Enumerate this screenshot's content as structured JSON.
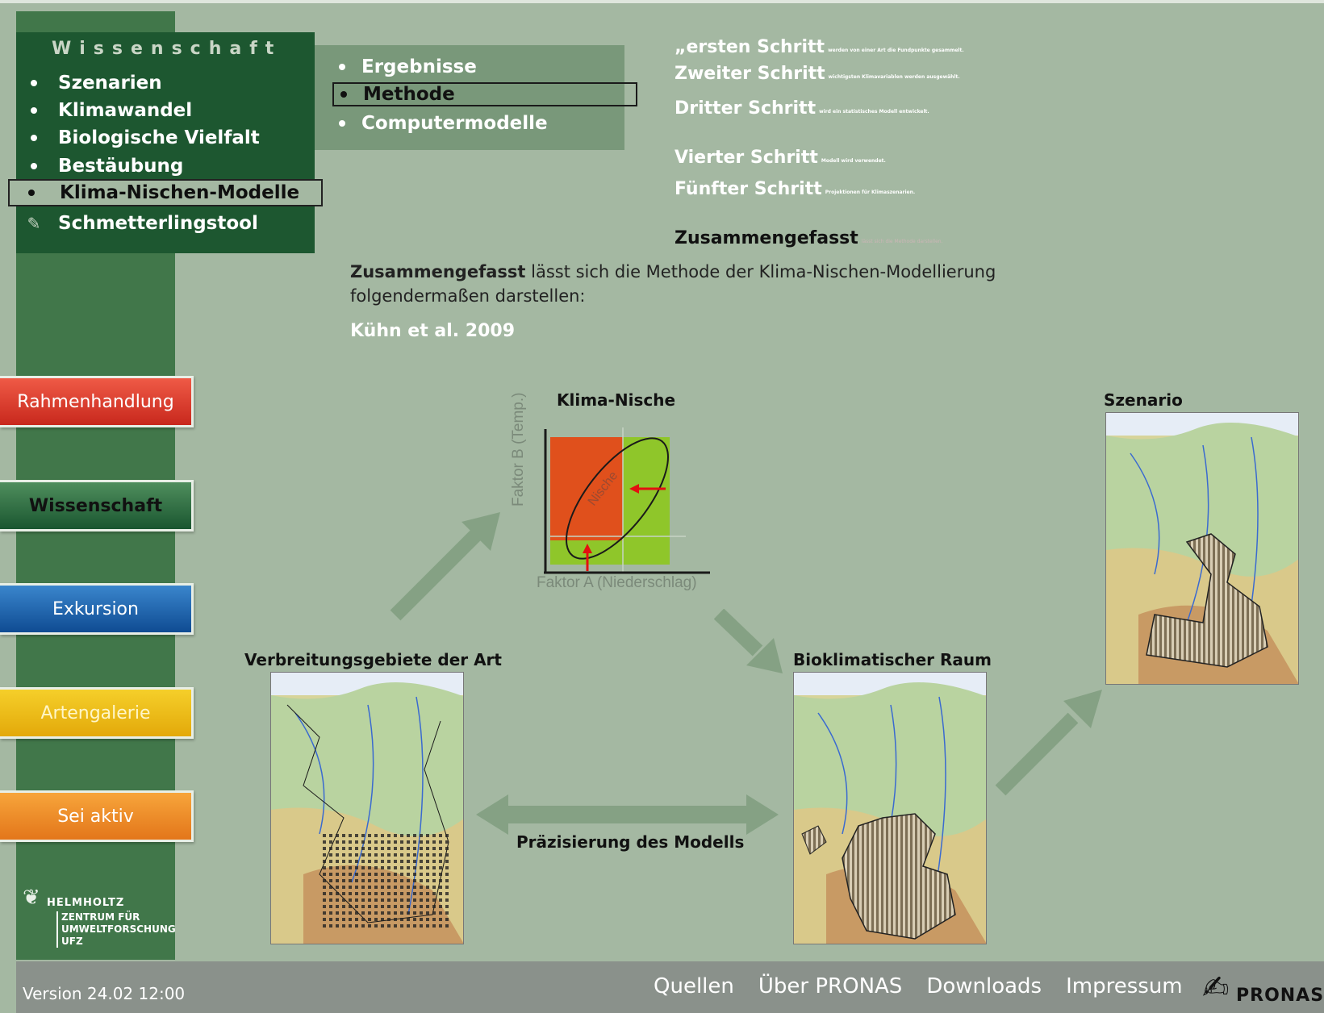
{
  "colors": {
    "background": "#a4b8a2",
    "nav_dark": "#1d5730",
    "nav_sub": "#79987a",
    "sidebar": "#41774a",
    "footer": "#8a918b"
  },
  "nav": {
    "heading": "Wissenschaft",
    "items": [
      {
        "label": "Szenarien"
      },
      {
        "label": "Klimawandel"
      },
      {
        "label": "Biologische Vielfalt"
      },
      {
        "label": "Bestäubung"
      },
      {
        "label": "Klima-Nischen-Modelle",
        "active": true
      },
      {
        "label": "Schmetterlingstool",
        "icon": "feather-icon"
      }
    ]
  },
  "subnav": {
    "items": [
      {
        "label": "Ergebnisse"
      },
      {
        "label": "Methode",
        "active": true
      },
      {
        "label": "Computermodelle"
      }
    ]
  },
  "steps": [
    {
      "title": "ersten Schritt",
      "prefix": "„",
      "text": "werden von einer Art die Fundpunkte gesammelt."
    },
    {
      "title": "Zweiter Schritt",
      "text": "wichtigsten Klimavariablen werden ausgewählt."
    },
    {
      "title": "Dritter Schritt",
      "text": "wird ein statistisches Modell entwickelt."
    },
    {
      "title": "Vierter Schritt",
      "text": "Modell wird verwendet."
    },
    {
      "title": "Fünfter Schritt",
      "text": "Projektionen für Klimaszenarien."
    },
    {
      "title": "Zusammengefasst",
      "text": "lässt sich die Methode darstellen."
    }
  ],
  "intro": {
    "bold": "Zusammengefasst",
    "text": " lässt sich die Methode der Klima-Nischen-Modellierung folgendermaßen darstellen:"
  },
  "citation": "Kühn et al. 2009",
  "side_buttons": {
    "rahmenhandlung": "Rahmenhandlung",
    "wissenschaft": "Wissenschaft",
    "exkursion": "Exkursion",
    "artengalerie": "Artengalerie",
    "sei_aktiv": "Sei aktiv"
  },
  "logo": {
    "line1": "HELMHOLTZ",
    "line2": "ZENTRUM FÜR",
    "line3": "UMWELTFORSCHUNG",
    "line4": "UFZ"
  },
  "diagram": {
    "niche_title": "Klima-Nische",
    "niche_y": "Faktor B (Temp.)",
    "niche_x": "Faktor A (Niederschlag)",
    "niche_word": "Nische",
    "scenario_title": "Szenario",
    "distribution_title": "Verbreitungsgebiete der Art",
    "bioclim_title": "Bioklimatischer Raum",
    "precision_label": "Präzisierung des Modells"
  },
  "footer": {
    "version": "Version 24.02 12:00",
    "links": [
      "Quellen",
      "Über PRONAS",
      "Downloads",
      "Impressum"
    ],
    "brand": "PRONAS"
  }
}
